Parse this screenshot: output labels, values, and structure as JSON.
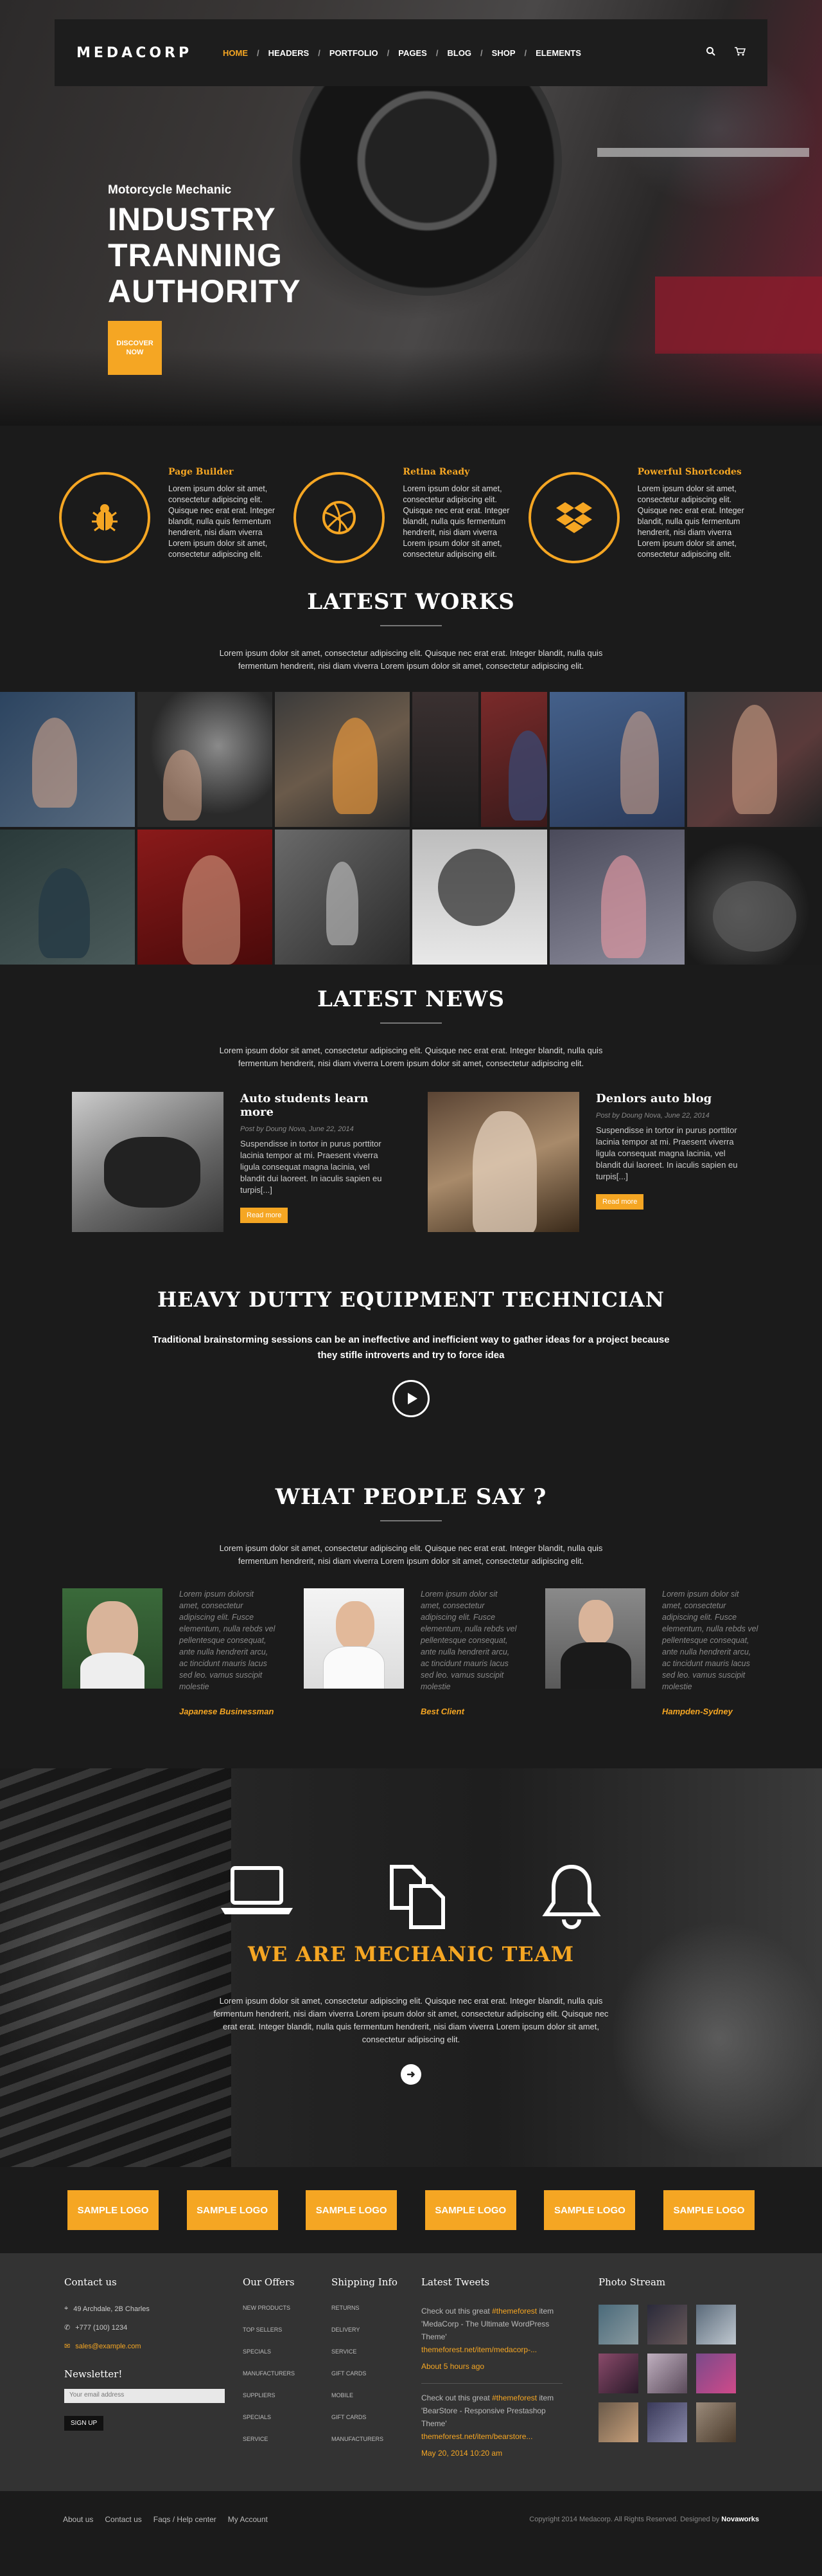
{
  "brand": {
    "logo": "MEDACORP",
    "accent": "#f5a623"
  },
  "nav": {
    "items": [
      "HOME",
      "HEADERS",
      "PORTFOLIO",
      "PAGES",
      "BLOG",
      "SHOP",
      "ELEMENTS"
    ],
    "active": "HOME",
    "icons": [
      "search-icon",
      "cart-icon"
    ]
  },
  "hero": {
    "subtitle": "Motorcycle Mechanic",
    "title_lines": [
      "INDUSTRY",
      "TRANNING",
      "AUTHORITY"
    ],
    "cta": "DISCOVER NOW"
  },
  "features": [
    {
      "title": "Page Builder",
      "icon": "bug-icon",
      "text": "Lorem ipsum dolor sit amet, consectetur adipiscing elit. Quisque nec erat erat. Integer blandit, nulla quis fermentum hendrerit, nisi diam viverra Lorem ipsum dolor sit amet, consectetur adipiscing elit."
    },
    {
      "title": "Retina Ready",
      "icon": "basketball-icon",
      "text": "Lorem ipsum dolor sit amet, consectetur adipiscing elit. Quisque nec erat erat. Integer blandit, nulla quis fermentum hendrerit, nisi diam viverra Lorem ipsum dolor sit amet, consectetur adipiscing elit."
    },
    {
      "title": "Powerful Shortcodes",
      "icon": "dropbox-icon",
      "text": "Lorem ipsum dolor sit amet, consectetur adipiscing elit. Quisque nec erat erat. Integer blandit, nulla quis fermentum hendrerit, nisi diam viverra Lorem ipsum dolor sit amet, consectetur adipiscing elit."
    }
  ],
  "works": {
    "title": "LATEST WORKS",
    "lead": "Lorem ipsum dolor sit amet, consectetur adipiscing elit. Quisque nec erat erat. Integer blandit, nulla quis fermentum hendrerit, nisi diam viverra Lorem ipsum dolor sit amet, consectetur adipiscing elit.",
    "tiles": [
      "#3e5670",
      "#5a5a5a",
      "#6a5a4a",
      "#3a3030",
      "#7a2a2a",
      "#44608a",
      "#3a3a3a",
      "#3a4a4a",
      "#8a1a1a",
      "#555555",
      "#bdbdbd",
      "#6a6a7a",
      "#2a2a2a"
    ]
  },
  "news": {
    "title": "LATEST NEWS",
    "lead": "Lorem ipsum dolor sit amet, consectetur adipiscing elit. Quisque nec erat erat. Integer blandit, nulla quis fermentum hendrerit, nisi diam viverra Lorem ipsum dolor sit amet, consectetur adipiscing elit.",
    "items": [
      {
        "title": "Auto students learn more",
        "meta": "Post by Doung Nova, June 22, 2014",
        "text": "Suspendisse in tortor in purus porttitor lacinia tempor at mi. Praesent viverra ligula consequat magna lacinia, vel blandit dui laoreet. In iaculis sapien eu turpis[...]",
        "button": "Read more"
      },
      {
        "title": "Denlors auto blog",
        "meta": "Post by Doung Nova, June 22, 2014",
        "text": "Suspendisse in tortor in purus porttitor lacinia tempor at mi. Praesent viverra ligula consequat magna lacinia, vel blandit dui laoreet. In iaculis sapien eu turpis[...]",
        "button": "Read more"
      }
    ]
  },
  "cta": {
    "title": "HEAVY DUTTY EQUIPMENT TECHNICIAN",
    "text": "Traditional brainstorming sessions can be an ineffective and inefficient way to gather ideas for a project because they stifle introverts and try to force idea"
  },
  "testimonials": {
    "title": "WHAT PEOPLE SAY ?",
    "lead": "Lorem ipsum dolor sit amet, consectetur adipiscing elit. Quisque nec erat erat. Integer blandit, nulla quis fermentum hendrerit, nisi diam viverra Lorem ipsum dolor sit amet, consectetur adipiscing elit.",
    "items": [
      {
        "text": "Lorem ipsum dolorsit amet, consectetur adipiscing elit. Fusce elementum, nulla rebds vel pellentesque consequat, ante nulla hendrerit arcu, ac tincidunt mauris lacus sed leo. vamus suscipit molestie",
        "name": "Japanese Businessman"
      },
      {
        "text": "Lorem ipsum dolor sit amet, consectetur adipiscing elit. Fusce elementum, nulla rebds vel pellentesque consequat, ante nulla hendrerit arcu, ac tincidunt mauris lacus sed leo. vamus suscipit molestie",
        "name": "Best Client"
      },
      {
        "text": "Lorem ipsum dolor sit amet, consectetur adipiscing elit. Fusce elementum, nulla rebds vel pellentesque consequat, ante nulla hendrerit arcu, ac tincidunt mauris lacus sed leo. vamus suscipit molestie",
        "name": "Hampden-Sydney"
      }
    ]
  },
  "banner": {
    "title": "WE ARE MECHANIC TEAM",
    "text": "Lorem ipsum dolor sit amet, consectetur adipiscing elit. Quisque nec erat erat. Integer blandit, nulla quis fermentum hendrerit, nisi diam viverra Lorem ipsum dolor sit amet, consectetur adipiscing elit. Quisque nec erat erat. Integer blandit, nulla quis fermentum hendrerit, nisi diam viverra Lorem ipsum dolor sit amet, consectetur adipiscing elit.",
    "icons": [
      "laptop-icon",
      "documents-icon",
      "bell-icon"
    ]
  },
  "logos": [
    "SAMPLE LOGO",
    "SAMPLE LOGO",
    "SAMPLE LOGO",
    "SAMPLE LOGO",
    "SAMPLE LOGO",
    "SAMPLE LOGO"
  ],
  "footer": {
    "contact": {
      "title": "Contact us",
      "address": "49 Archdale, 2B Charles",
      "phone": "+777 (100) 1234",
      "email": "sales@example.com"
    },
    "newsletter": {
      "title": "Newsletter!",
      "placeholder": "Your email address",
      "button": "SIGN UP"
    },
    "offers": {
      "title": "Our Offers",
      "links": [
        "NEW PRODUCTS",
        "TOP SELLERS",
        "SPECIALS",
        "MANUFACTURERS",
        "SUPPLIERS",
        "SPECIALS",
        "SERVICE"
      ]
    },
    "shipping": {
      "title": "Shipping Info",
      "links": [
        "RETURNS",
        "DELIVERY",
        "SERVICE",
        "GIFT CARDS",
        "MOBILE",
        "GIFT CARDS",
        "MANUFACTURERS"
      ]
    },
    "tweets": {
      "title": "Latest Tweets",
      "items": [
        {
          "pre": "Check out this great",
          "hash": "#themeforest",
          "post": "item 'MedaCorp - The Ultimate WordPress Theme'",
          "link": "themeforest.net/item/medacorp-...",
          "time": "About 5 hours ago"
        },
        {
          "pre": "Check out this great",
          "hash": "#themeforest",
          "post": "item 'BearStore - Responsive Prestashop Theme'",
          "link": "themeforest.net/item/bearstore...",
          "time": "May 20, 2014 10:20 am"
        }
      ]
    },
    "photos": {
      "title": "Photo Stream",
      "tiles": [
        "#4a6a7a",
        "#3a3a4a",
        "#5a6a7a",
        "#8a4a6a",
        "#c0b0c0",
        "#7a4a8a",
        "#6a5a4a",
        "#3a3a5a",
        "#9a8a7a"
      ]
    }
  },
  "bottom": {
    "links": [
      "About us",
      "Contact us",
      "Faqs / Help center",
      "My Account"
    ],
    "copyright": "Copyright 2014 Medacorp. All Rights Reserved. Designed by",
    "designer": "Novaworks"
  }
}
